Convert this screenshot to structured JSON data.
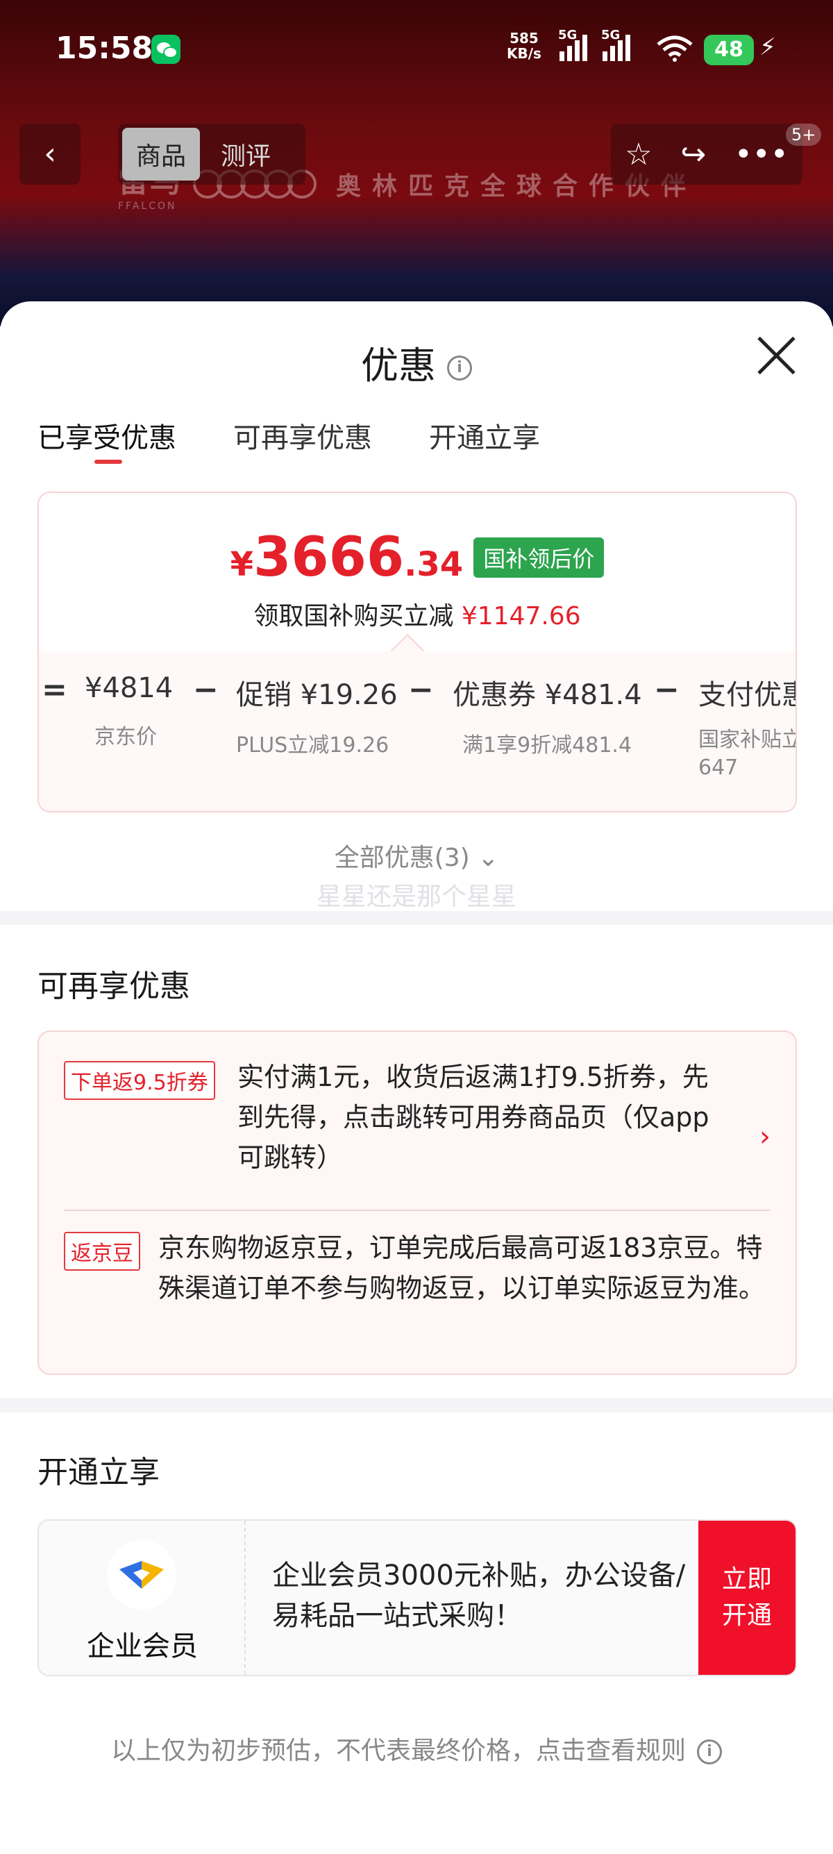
{
  "status_bar": {
    "time": "15:58",
    "net_speed_value": "585",
    "net_speed_unit": "KB/s",
    "signal1_tag": "5G",
    "signal2_tag": "5G",
    "battery": "48"
  },
  "background": {
    "brand_logo": "雷鸟",
    "brand_sub": "FFALCON",
    "brand_text": "奥林匹克全球合作伙伴"
  },
  "nav": {
    "back_icon": "‹",
    "tabs": [
      "商品",
      "测评"
    ],
    "more_badge": "5+"
  },
  "sheet": {
    "title": "优惠",
    "tabs": [
      "已享受优惠",
      "可再享优惠",
      "开通立享"
    ]
  },
  "price_card": {
    "currency": "¥",
    "price_int": "3666",
    "price_dec": ".34",
    "badge": "国补领后价",
    "sub_text": "领取国补购买立减",
    "sub_amount": "¥1147.66",
    "calc": [
      {
        "op": "=",
        "main": "¥4814",
        "note": "京东价"
      },
      {
        "op": "−",
        "main": "促销 ¥19.26",
        "note": "PLUS立减19.26"
      },
      {
        "op": "−",
        "main": "优惠券 ¥481.4",
        "note": "满1享9折减481.4"
      },
      {
        "op": "−",
        "main": "支付优惠",
        "note": "国家补贴立",
        "note2": "647"
      }
    ]
  },
  "all_coupons": "全部优惠(3)",
  "watermark": "星星还是那个星星",
  "more_section": {
    "title": "可再享优惠",
    "items": [
      {
        "tag": "下单返9.5折券",
        "text": "实付满1元，收货后返满1打9.5折券，先到先得，点击跳转可用券商品页（仅app可跳转）"
      },
      {
        "tag": "返京豆",
        "text": "京东购物返京豆，订单完成后最高可返183京豆。特殊渠道订单不参与购物返豆，以订单实际返豆为准。"
      }
    ]
  },
  "open_section": {
    "title": "开通立享",
    "member_name": "企业会员",
    "member_desc": "企业会员3000元补贴，办公设备/易耗品一站式采购！",
    "button": "立即开通"
  },
  "disclaimer": "以上仅为初步预估，不代表最终价格，点击查看规则",
  "colors": {
    "accent_red": "#e4202a",
    "badge_green": "#2da44e",
    "button_red": "#f0102a"
  }
}
